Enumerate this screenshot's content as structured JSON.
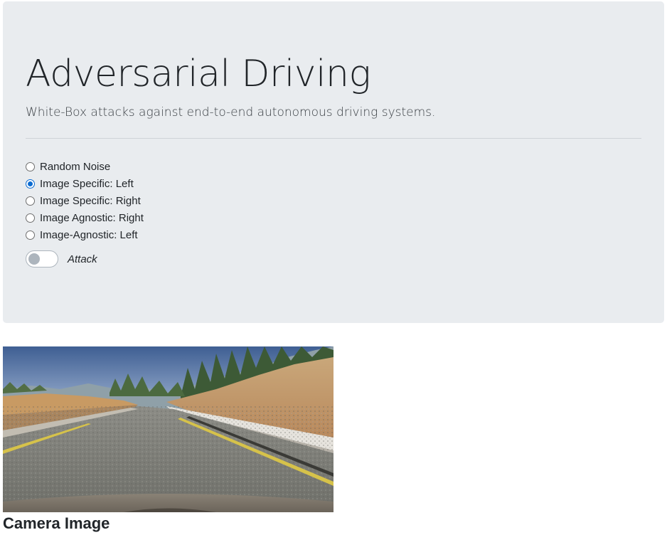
{
  "header": {
    "title": "Adversarial Driving",
    "subtitle": "White-Box attacks against end-to-end autonomous driving systems."
  },
  "attack_options": {
    "selected_index": 1,
    "options": [
      {
        "label": "Random Noise",
        "checked": false
      },
      {
        "label": "Image Specific: Left",
        "checked": true
      },
      {
        "label": "Image Specific: Right",
        "checked": false
      },
      {
        "label": "Image Agnostic: Right",
        "checked": false
      },
      {
        "label": "Image-Agnostic: Left",
        "checked": false
      }
    ]
  },
  "attack_switch": {
    "label": "Attack",
    "on": false
  },
  "camera": {
    "caption": "Camera Image",
    "scene": "simulated road with trees, sandy hills and car hood"
  },
  "colors": {
    "jumbotron_bg": "#e9ecef",
    "radio_accent": "#0b6bd1",
    "switch_off": "#adb5bd"
  }
}
